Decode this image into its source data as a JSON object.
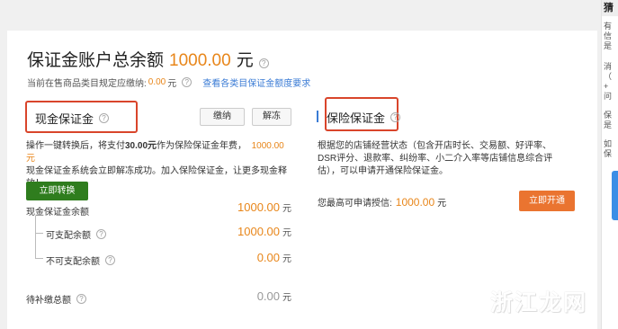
{
  "account": {
    "title": "保证金账户总余额",
    "amount": "1000.00",
    "unit": "元",
    "help": "?"
  },
  "requirement": {
    "label": "当前在售商品类目规定应缴纳:",
    "value": "0.00",
    "unit": "元",
    "help": "?",
    "link": "查看各类目保证金额度要求"
  },
  "cash_section": {
    "title": "现金保证金",
    "help": "?",
    "pay_button": "缴纳",
    "unfreeze_button": "解冻",
    "desc_part1": "操作一键转换后，将支付",
    "desc_fee": "30.00元",
    "desc_part2": "作为保险保证金年费，",
    "desc_amount": "1000.00元",
    "desc_part3": "现金保证金系统会立即解冻成功。加入保险保证金，让更多现金释放！",
    "convert_button": "立即转换",
    "rows": [
      {
        "label": "现金保证金余额",
        "value": "1000.00",
        "unit": "元"
      },
      {
        "label": "可支配余额",
        "value": "1000.00",
        "unit": "元",
        "help": "?"
      },
      {
        "label": "不可支配余额",
        "value": "0.00",
        "unit": "元",
        "help": "?"
      }
    ],
    "pending": {
      "label": "待补缴总额",
      "value": "0.00",
      "unit": "元",
      "help": "?"
    }
  },
  "insurance_section": {
    "title": "保险保证金",
    "help": "?",
    "desc": "根据您的店铺经营状态（包含开店时长、交易额、好评率、DSR评分、退款率、纠纷率、小二介入率等店铺信息综合评估），可以申请开通保险保证金。",
    "credit_label": "您最高可申请授信:",
    "credit_value": "1000.00",
    "credit_unit": "元",
    "open_button": "立即开通"
  },
  "side_panel": {
    "header": "猜",
    "lines": [
      "有",
      "信",
      "是",
      "消",
      "（",
      "+",
      "问",
      "保",
      "是",
      "如",
      "保"
    ]
  },
  "watermark": "浙江龙网",
  "colors": {
    "accent_orange": "#e8861a",
    "link_blue": "#3a7bd5",
    "green_button": "#2f7d1e",
    "orange_button": "#ea7430",
    "highlight_red": "#d9452b"
  }
}
